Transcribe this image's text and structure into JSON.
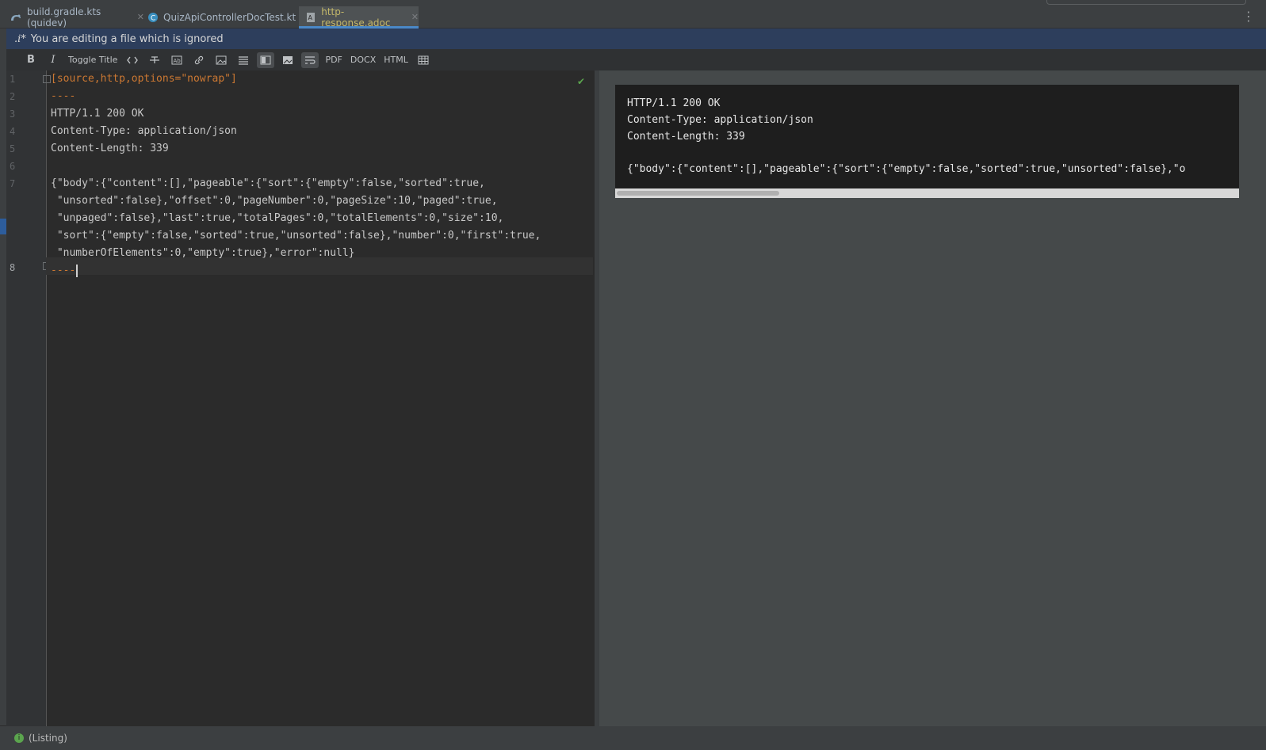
{
  "tabs": [
    {
      "label": "build.gradle.kts (quidev)",
      "icon": "gradle-icon",
      "active": false
    },
    {
      "label": "QuizApiControllerDocTest.kt",
      "icon": "kotlin-class-icon",
      "active": false
    },
    {
      "label": "http-response.adoc",
      "icon": "asciidoc-file-icon",
      "active": true
    }
  ],
  "banner": {
    "icon_text": ".i*",
    "message": "You are editing a file which is ignored"
  },
  "toolbar": {
    "bold": "B",
    "italic": "I",
    "toggle_title": "Toggle Title",
    "pdf": "PDF",
    "docx": "DOCX",
    "html": "HTML"
  },
  "editor": {
    "line_numbers": [
      "1",
      "2",
      "3",
      "4",
      "5",
      "6",
      "7",
      "8"
    ],
    "lines": [
      "[source,http,options=\"nowrap\"]",
      "----",
      "HTTP/1.1 200 OK",
      "Content-Type: application/json",
      "Content-Length: 339",
      "",
      "{\"body\":{\"content\":[],\"pageable\":{\"sort\":{\"empty\":false,\"sorted\":true,",
      " \"unsorted\":false},\"offset\":0,\"pageNumber\":0,\"pageSize\":10,\"paged\":true,",
      " \"unpaged\":false},\"last\":true,\"totalPages\":0,\"totalElements\":0,\"size\":10,",
      " \"sort\":{\"empty\":false,\"sorted\":true,\"unsorted\":false},\"number\":0,\"first\":true,",
      " \"numberOfElements\":0,\"empty\":true},\"error\":null}",
      "----"
    ]
  },
  "preview": {
    "lines": [
      "HTTP/1.1 200 OK",
      "Content-Type: application/json",
      "Content-Length: 339",
      "",
      "{\"body\":{\"content\":[],\"pageable\":{\"sort\":{\"empty\":false,\"sorted\":true,\"unsorted\":false},\"o"
    ]
  },
  "status": {
    "text": "(Listing)"
  }
}
